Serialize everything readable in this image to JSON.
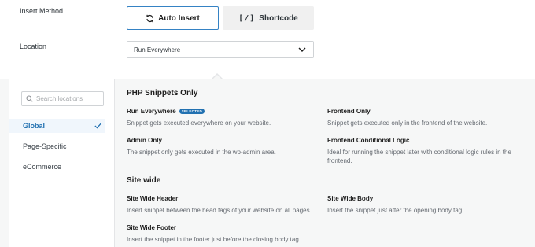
{
  "insert_method": {
    "label": "Insert Method",
    "auto_insert_label": "Auto Insert",
    "shortcode_icon_text": "[/]",
    "shortcode_label": "Shortcode",
    "selected": "auto_insert"
  },
  "location": {
    "label": "Location",
    "selected_value": "Run Everywhere"
  },
  "dropdown": {
    "search_placeholder": "Search locations",
    "categories": [
      {
        "label": "Global",
        "active": true
      },
      {
        "label": "Page-Specific",
        "active": false
      },
      {
        "label": "eCommerce",
        "active": false
      }
    ],
    "sections": [
      {
        "title": "PHP Snippets Only",
        "options": [
          {
            "title": "Run Everywhere",
            "badge": "SELECTED",
            "description": "Snippet gets executed everywhere on your website."
          },
          {
            "title": "Frontend Only",
            "description": "Snippet gets executed only in the frontend of the website."
          },
          {
            "title": "Admin Only",
            "description": "The snippet only gets executed in the wp-admin area."
          },
          {
            "title": "Frontend Conditional Logic",
            "description": "Ideal for running the snippet later with conditional logic rules in the frontend."
          }
        ]
      },
      {
        "title": "Site wide",
        "options": [
          {
            "title": "Site Wide Header",
            "description": "Insert snippet between the head tags of your website on all pages."
          },
          {
            "title": "Site Wide Body",
            "description": "Insert the snippet just after the opening body tag."
          },
          {
            "title": "Site Wide Footer",
            "description": "Insert the snippet in the footer just before the closing body tag."
          }
        ]
      }
    ]
  },
  "colors": {
    "accent": "#2271b1",
    "active_border": "#3582c4",
    "panel_bg": "#f6f7f7",
    "sidebar_active_bg": "#f0f6fc"
  }
}
